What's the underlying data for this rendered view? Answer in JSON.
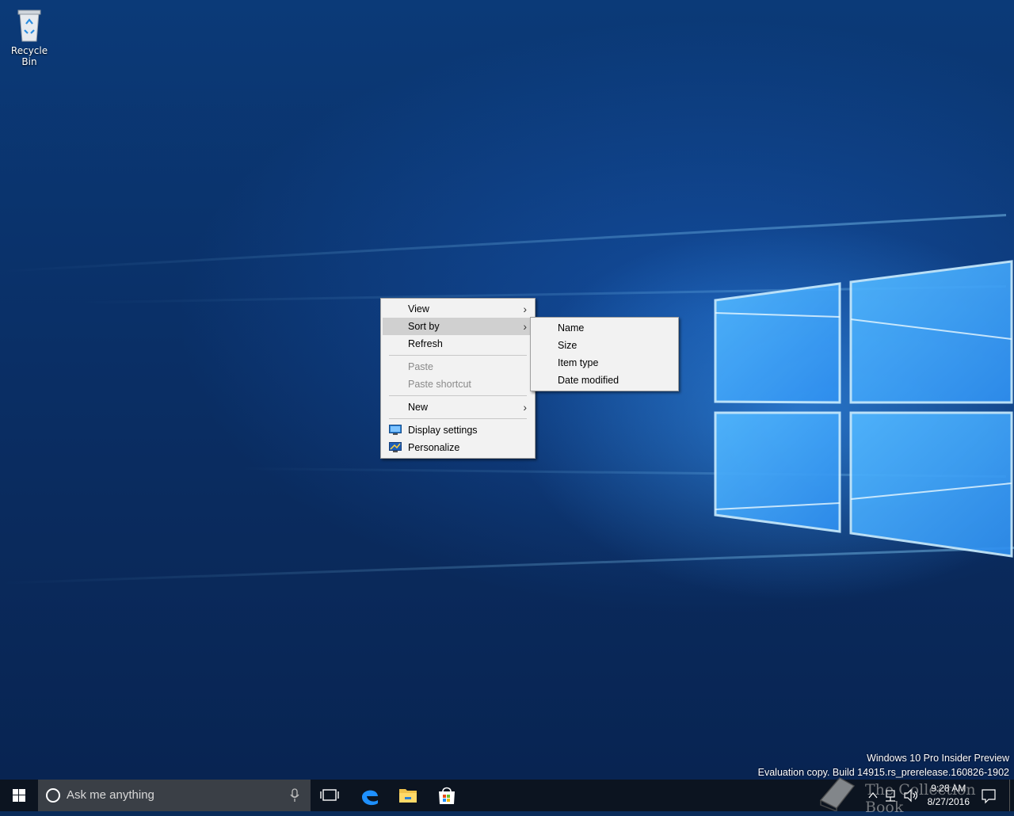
{
  "desktop": {
    "icons": [
      {
        "label": "Recycle Bin",
        "icon": "recycle-bin-icon"
      }
    ],
    "watermark": {
      "line1": "Windows 10 Pro Insider Preview",
      "line2": "Evaluation copy. Build 14915.rs_prerelease.160826-1902"
    }
  },
  "context_menu": {
    "items": {
      "view": "View",
      "sort_by": "Sort by",
      "refresh": "Refresh",
      "paste": "Paste",
      "paste_shortcut": "Paste shortcut",
      "new": "New",
      "display_settings": "Display settings",
      "personalize": "Personalize"
    },
    "highlighted": "Sort by",
    "disabled": [
      "Paste",
      "Paste shortcut"
    ]
  },
  "sort_submenu": {
    "items": {
      "name": "Name",
      "size": "Size",
      "item_type": "Item type",
      "date_modified": "Date modified"
    }
  },
  "taskbar": {
    "search_placeholder": "Ask me anything",
    "pinned": [
      "task-view-icon",
      "edge-icon",
      "file-explorer-icon",
      "store-icon"
    ],
    "clock": {
      "time": "9:28 AM",
      "date": "8/27/2016"
    }
  },
  "overlay": {
    "credit_text": "The Collection Book"
  },
  "colors": {
    "taskbar": "#0c1420",
    "search_box": "#3a3f46",
    "menu_bg": "#f2f2f2",
    "menu_highlight": "#d0d0d0",
    "accent": "#1e90ff"
  }
}
